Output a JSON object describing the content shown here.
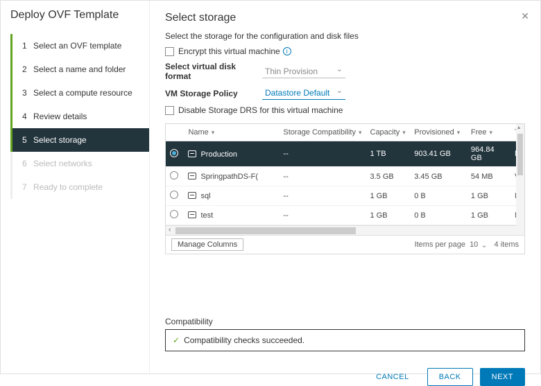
{
  "wizard_title": "Deploy OVF Template",
  "close_glyph": "✕",
  "steps": [
    {
      "num": "1",
      "label": "Select an OVF template"
    },
    {
      "num": "2",
      "label": "Select a name and folder"
    },
    {
      "num": "3",
      "label": "Select a compute resource"
    },
    {
      "num": "4",
      "label": "Review details"
    },
    {
      "num": "5",
      "label": "Select storage"
    },
    {
      "num": "6",
      "label": "Select networks"
    },
    {
      "num": "7",
      "label": "Ready to complete"
    }
  ],
  "page": {
    "title": "Select storage",
    "subtitle": "Select the storage for the configuration and disk files",
    "encrypt_label": "Encrypt this virtual machine",
    "disk_format_label": "Select virtual disk format",
    "disk_format_value": "Thin Provision",
    "policy_label": "VM Storage Policy",
    "policy_value": "Datastore Default",
    "disable_drs_label": "Disable Storage DRS for this virtual machine"
  },
  "columns": {
    "name": "Name",
    "compat": "Storage Compatibility",
    "capacity": "Capacity",
    "provisioned": "Provisioned",
    "free": "Free",
    "t": "T"
  },
  "rows": [
    {
      "name": "Production",
      "compat": "--",
      "capacity": "1 TB",
      "provisioned": "903.41 GB",
      "free": "964.84 GB",
      "t": "N"
    },
    {
      "name": "SpringpathDS-F(",
      "compat": "--",
      "capacity": "3.5 GB",
      "provisioned": "3.45 GB",
      "free": "54 MB",
      "t": "V"
    },
    {
      "name": "sql",
      "compat": "--",
      "capacity": "1 GB",
      "provisioned": "0 B",
      "free": "1 GB",
      "t": "N"
    },
    {
      "name": "test",
      "compat": "--",
      "capacity": "1 GB",
      "provisioned": "0 B",
      "free": "1 GB",
      "t": "N"
    }
  ],
  "footer": {
    "manage_columns": "Manage Columns",
    "items_per_page_label": "Items per page",
    "items_per_page_value": "10",
    "count_label": "4 items"
  },
  "compat": {
    "label": "Compatibility",
    "message": "Compatibility checks succeeded."
  },
  "buttons": {
    "cancel": "CANCEL",
    "back": "BACK",
    "next": "NEXT"
  },
  "glyphs": {
    "filter": "▾",
    "check": "✓",
    "chev": "⌄"
  }
}
